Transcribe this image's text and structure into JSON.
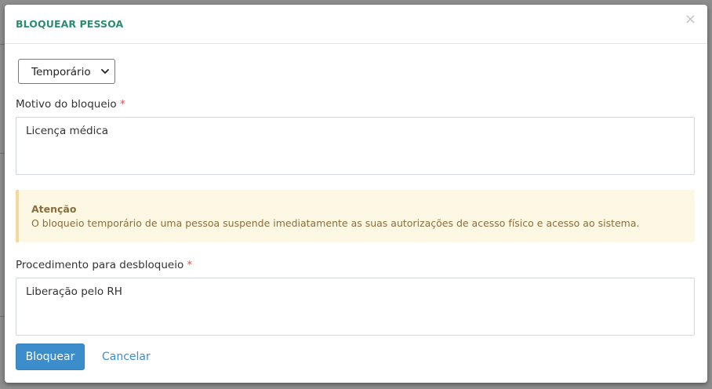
{
  "modal": {
    "title": "BLOQUEAR PESSOA",
    "close_glyph": "×"
  },
  "block_type": {
    "selected": "Temporário"
  },
  "reason": {
    "label": "Motivo do bloqueio",
    "required_mark": "*",
    "value": "Licença médica"
  },
  "alert": {
    "title": "Atenção",
    "text": "O bloqueio temporário de uma pessoa suspende imediatamente as suas autorizações de acesso físico e acesso ao sistema."
  },
  "unblock_procedure": {
    "label": "Procedimento para desbloqueio",
    "required_mark": "*",
    "value": "Liberação pelo RH"
  },
  "actions": {
    "primary_label": "Bloquear",
    "cancel_label": "Cancelar"
  },
  "colors": {
    "title": "#2e8b73",
    "primary": "#3c8dcc",
    "required": "#d9534f",
    "alert_bg": "#fcf8e3",
    "alert_text": "#8a6d3b"
  }
}
